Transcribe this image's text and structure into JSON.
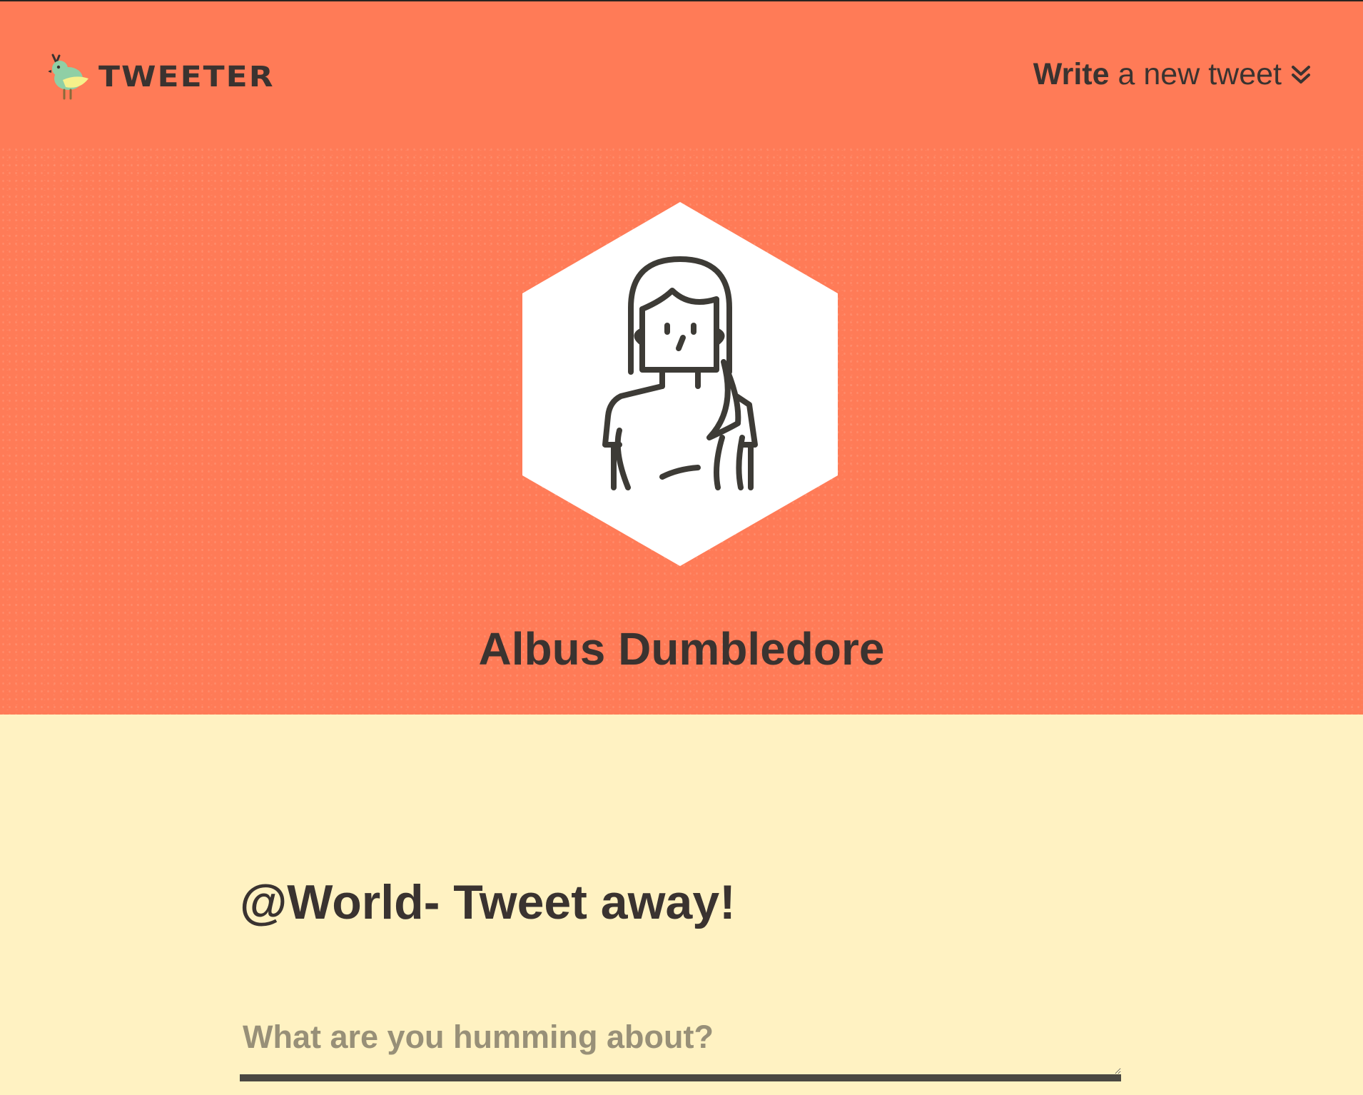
{
  "navbar": {
    "brand": "TWEETER",
    "write_strong": "Write",
    "write_rest": "a new tweet"
  },
  "profile": {
    "name": "Albus Dumbledore"
  },
  "composer": {
    "title": "@World- Tweet away!",
    "placeholder": "What are you humming about?",
    "value": ""
  },
  "colors": {
    "header_bg": "#ff7b57",
    "page_bg": "#fff2c2",
    "text": "#3a3330",
    "placeholder": "#989078",
    "input_border": "#4a4842"
  },
  "icons": {
    "brand": "bird-logo-icon",
    "write_toggle": "double-chevron-down-icon",
    "avatar": "person-avatar-icon"
  }
}
